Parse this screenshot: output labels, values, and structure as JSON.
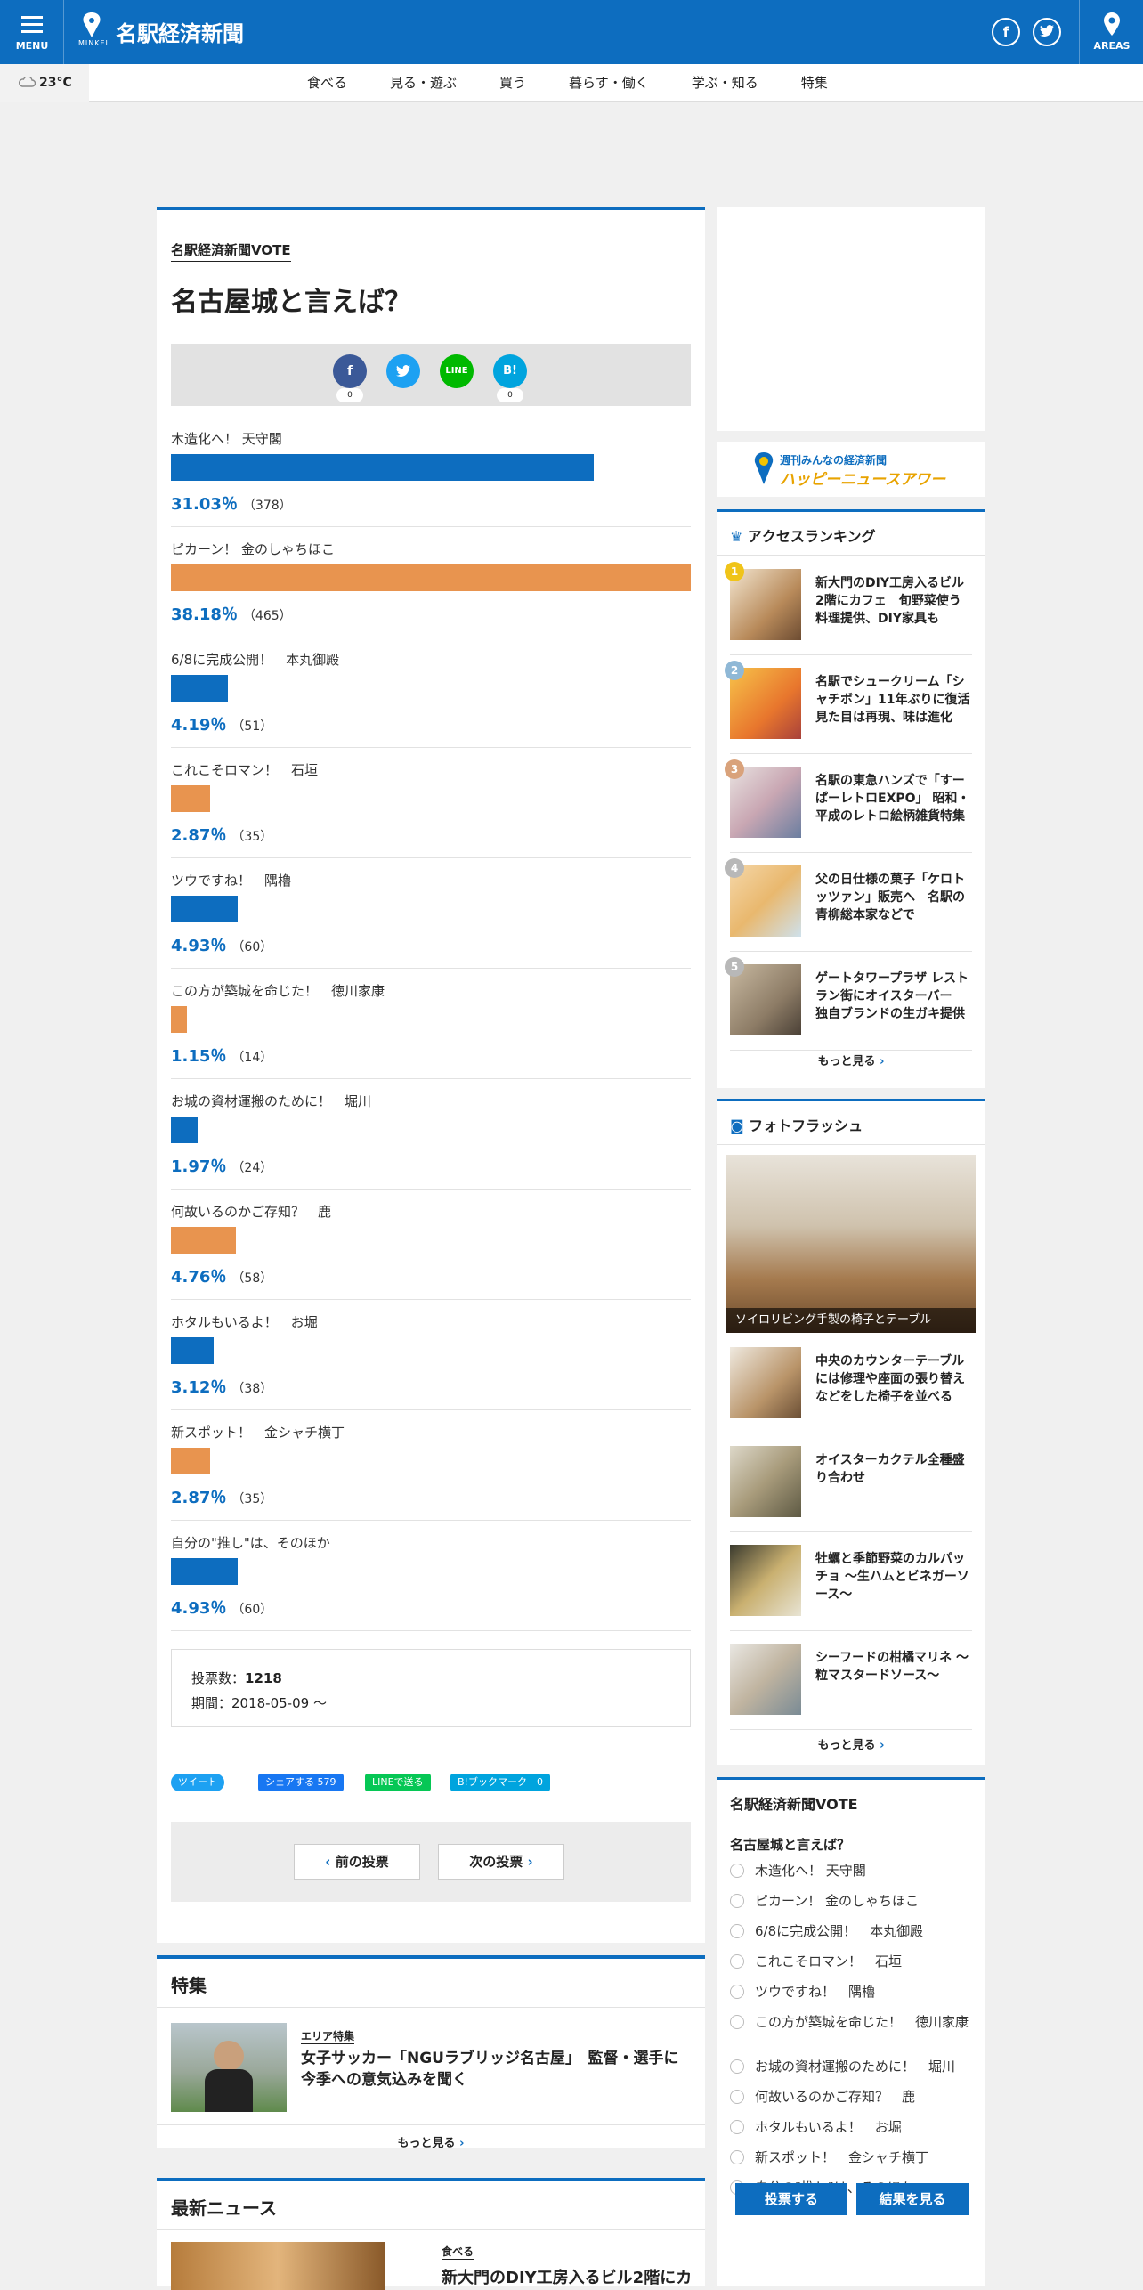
{
  "header": {
    "menu_label": "MENU",
    "logo_sub": "MINKEI",
    "site_name": "名駅経済新聞",
    "areas_label": "AREAS",
    "facebook_icon": "f",
    "twitter_icon": "t"
  },
  "weather": {
    "temp": "23°C"
  },
  "nav": [
    "食べる",
    "見る・遊ぶ",
    "買う",
    "暮らす・働く",
    "学ぶ・知る",
    "特集"
  ],
  "vote": {
    "label": "名駅経済新聞VOTE",
    "title": "名古屋城と言えば？",
    "share": {
      "line": "LINE",
      "hatena": "B!",
      "fb_count": "0",
      "hatena_count": "0"
    },
    "options": [
      {
        "label": "木造化へ！ 天守閣",
        "pct": "31.03％",
        "count": "（378）",
        "percent": 31.03,
        "color": "#0d6dbf"
      },
      {
        "label": "ピカーン！ 金のしゃちほこ",
        "pct": "38.18％",
        "count": "（465）",
        "percent": 38.18,
        "color": "#e8944f"
      },
      {
        "label": "6/8に完成公開！　本丸御殿",
        "pct": "4.19％",
        "count": "（51）",
        "percent": 4.19,
        "color": "#0d6dbf"
      },
      {
        "label": "これこそロマン！　石垣",
        "pct": "2.87％",
        "count": "（35）",
        "percent": 2.87,
        "color": "#e8944f"
      },
      {
        "label": "ツウですね！　隅櫓",
        "pct": "4.93％",
        "count": "（60）",
        "percent": 4.93,
        "color": "#0d6dbf"
      },
      {
        "label": "この方が築城を命じた！　徳川家康",
        "pct": "1.15％",
        "count": "（14）",
        "percent": 1.15,
        "color": "#e8944f"
      },
      {
        "label": "お城の資材運搬のために！　堀川",
        "pct": "1.97％",
        "count": "（24）",
        "percent": 1.97,
        "color": "#0d6dbf"
      },
      {
        "label": "何故いるのかご存知？　鹿",
        "pct": "4.76％",
        "count": "（58）",
        "percent": 4.76,
        "color": "#e8944f"
      },
      {
        "label": "ホタルもいるよ！　お堀",
        "pct": "3.12％",
        "count": "（38）",
        "percent": 3.12,
        "color": "#0d6dbf"
      },
      {
        "label": "新スポット！　金シャチ横丁",
        "pct": "2.87％",
        "count": "（35）",
        "percent": 2.87,
        "color": "#e8944f"
      },
      {
        "label": "自分の\"推し\"は、そのほか",
        "pct": "4.93％",
        "count": "（60）",
        "percent": 4.93,
        "color": "#0d6dbf"
      }
    ],
    "total_label": "投票数：",
    "total": "1218",
    "period": "期間：2018-05-09 ～"
  },
  "share_buttons": {
    "tweet": "ツイート",
    "fb": "シェアする 579",
    "line": "LINEで送る",
    "hatena": "B!ブックマーク　0"
  },
  "pager": {
    "prev": "前の投票",
    "next": "次の投票"
  },
  "feature": {
    "heading": "特集",
    "tag": "エリア特集",
    "title": "女子サッカー「NGUラブリッジ名古屋」　監督・選手に今季への意気込みを聞く",
    "more": "もっと見る"
  },
  "news": {
    "heading": "最新ニュース",
    "tag": "食べる",
    "title": "新大門のDIY工房入るビル2階にカ"
  },
  "sidebar": {
    "hna": {
      "line1": "週刊みんなの経済新聞",
      "line2": "ハッピーニュースアワー"
    },
    "ranking": {
      "heading": "アクセスランキング",
      "items": [
        {
          "num": "1",
          "title": "新大門のDIY工房入るビル2階にカフェ　旬野菜使う料理提供、DIY家具も"
        },
        {
          "num": "2",
          "title": "名駅でシュークリーム「シャチボン」11年ぶりに復活　見た目は再現、味は進化"
        },
        {
          "num": "3",
          "title": "名駅の東急ハンズで「すーぱーレトロEXPO」 昭和・平成のレトロ絵柄雑貨特集"
        },
        {
          "num": "4",
          "title": "父の日仕様の菓子「ケロトッツァン」販売へ　名駅の青柳総本家などで"
        },
        {
          "num": "5",
          "title": "ゲートタワープラザ レストラン街にオイスターバー　独自ブランドの生ガキ提供"
        }
      ],
      "more": "もっと見る"
    },
    "photo": {
      "heading": "フォトフラッシュ",
      "caption": "ソイロリビング手製の椅子とテーブル",
      "items": [
        "中央のカウンターテーブルには修理や座面の張り替えなどをした椅子を並べる",
        "オイスターカクテル全種盛り合わせ",
        "牡蠣と季節野菜のカルパッチョ ～生ハムとビネガーソース～",
        "シーフードの柑橘マリネ ～粒マスタードソース～"
      ],
      "more": "もっと見る"
    },
    "vote": {
      "label": "名駅経済新聞VOTE",
      "title": "名古屋城と言えば？",
      "options": [
        "木造化へ！ 天守閣",
        "ピカーン！ 金のしゃちほこ",
        "6/8に完成公開！　本丸御殿",
        "これこそロマン！　石垣",
        "ツウですね！　隅櫓",
        "この方が築城を命じた！　徳川家康",
        "お城の資材運搬のために！　堀川",
        "何故いるのかご存知？　鹿",
        "ホタルもいるよ！　お堀",
        "新スポット！　金シャチ横丁",
        "自分の\"推し\"は、そのほか"
      ],
      "vote_btn": "投票する",
      "result_btn": "結果を見る"
    }
  }
}
